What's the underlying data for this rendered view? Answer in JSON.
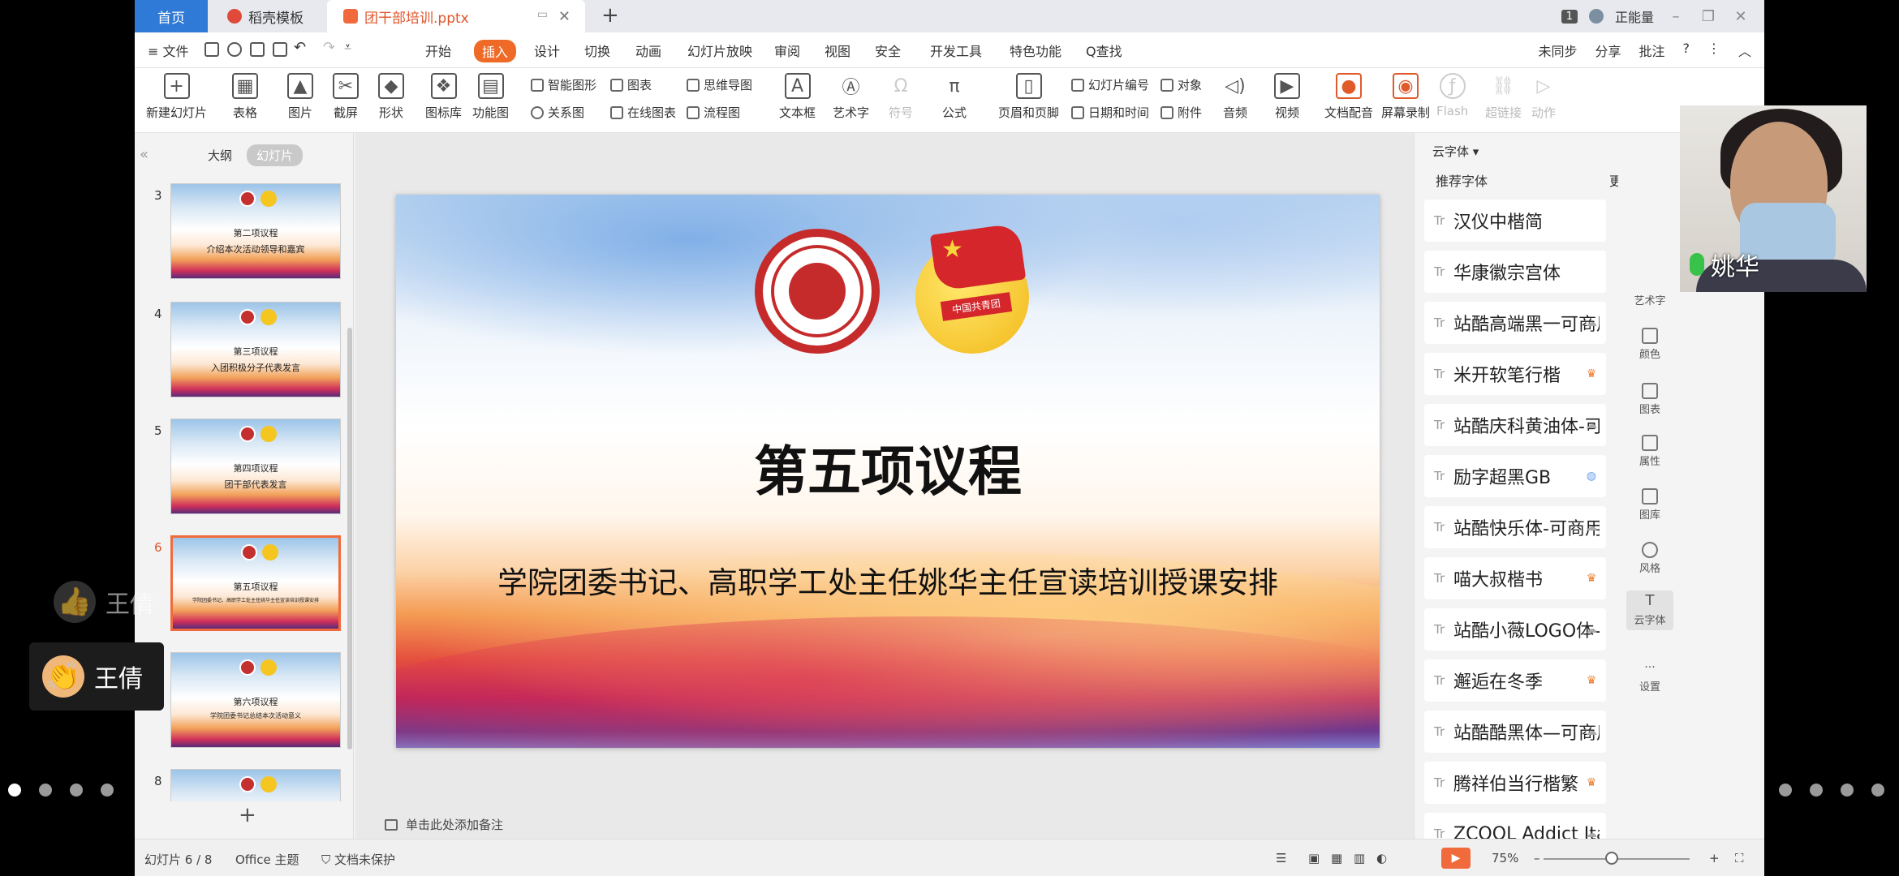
{
  "tabs": {
    "home": "首页",
    "template": "稻壳模板",
    "file": "团干部培训.pptx",
    "add": "+"
  },
  "titlebar_right": {
    "badge": "1",
    "user": "正能量",
    "min": "–",
    "max": "❐",
    "close": "✕"
  },
  "menu": {
    "file": "≡ 文件",
    "items": [
      "开始",
      "插入",
      "设计",
      "切换",
      "动画",
      "幻灯片放映",
      "审阅",
      "视图",
      "安全",
      "开发工具",
      "特色功能"
    ],
    "search": "Q查找",
    "sync": "未同步",
    "share": "分享",
    "comment": "批注",
    "help": "?",
    "more": "⋮",
    "collapse": "︿"
  },
  "ribbon": {
    "new_slide": "新建幻灯片",
    "table": "表格",
    "picture": "图片",
    "screenshot": "截屏",
    "shape": "形状",
    "icon_lib": "图标库",
    "func_chart": "功能图",
    "smart_graphic": "智能图形",
    "chart": "图表",
    "relation": "关系图",
    "online_chart": "在线图表",
    "mindmap": "思维导图",
    "flowchart": "流程图",
    "textbox": "文本框",
    "wordart": "艺术字",
    "symbol": "符号",
    "formula": "公式",
    "header_footer": "页眉和页脚",
    "slide_number": "幻灯片编号",
    "object": "对象",
    "date_time": "日期和时间",
    "attachment": "附件",
    "audio": "音频",
    "video": "视频",
    "doc_dub": "文档配音",
    "screen_record": "屏幕录制",
    "flash": "Flash",
    "hyperlink": "超链接",
    "action": "动作"
  },
  "left_panel": {
    "outline": "大纲",
    "slides": "幻灯片",
    "thumbnails": [
      {
        "num": "3",
        "line1": "第二项议程",
        "line2": "介绍本次活动领导和嘉宾"
      },
      {
        "num": "4",
        "line1": "第三项议程",
        "line2": "入团积极分子代表发言"
      },
      {
        "num": "5",
        "line1": "第四项议程",
        "line2": "团干部代表发言"
      },
      {
        "num": "6",
        "line1": "第五项议程",
        "line2": "学院团委书记、高职学工处主任姚华主任宣读培训授课安排"
      },
      {
        "num": "7",
        "line1": "第六项议程",
        "line2": "学院团委书记总结本次活动意义"
      },
      {
        "num": "8",
        "line1": "",
        "line2": ""
      }
    ]
  },
  "slide": {
    "title": "第五项议程",
    "subtitle": "学院团委书记、高职学工处主任姚华主任宣读培训授课安排",
    "emblem_text": "中国共青团"
  },
  "notes_placeholder": "单击此处添加备注",
  "font_panel": {
    "header": "云字体",
    "section": "推荐字体",
    "more": "更",
    "fonts": [
      {
        "name": "汉仪中楷简",
        "status": ""
      },
      {
        "name": "华康徽宗宫体",
        "status": ""
      },
      {
        "name": "站酷高端黑一可商用",
        "status": "cloud"
      },
      {
        "name": "米开软笔行楷",
        "status": "crown"
      },
      {
        "name": "站酷庆科黄油体-可商用",
        "status": "cloud"
      },
      {
        "name": "励字超黑GB",
        "status": "shield"
      },
      {
        "name": "站酷快乐体-可商用",
        "status": "cloud"
      },
      {
        "name": "喵大叔楷书",
        "status": "crown"
      },
      {
        "name": "站酷小薇LOGO体-可商用",
        "status": "cloud"
      },
      {
        "name": "邂逅在冬季",
        "status": "crown"
      },
      {
        "name": "站酷酷黑体—可商用",
        "status": "cloud"
      },
      {
        "name": "腾祥伯当行楷繁",
        "status": "crown"
      },
      {
        "name": "ZCOOL Addict Italic",
        "status": "cloud"
      }
    ]
  },
  "tool_rail": [
    {
      "label": "艺术字"
    },
    {
      "label": "颜色"
    },
    {
      "label": "图表"
    },
    {
      "label": "属性"
    },
    {
      "label": "图库"
    },
    {
      "label": "风格"
    },
    {
      "label": "云字体"
    },
    {
      "label": "设置"
    }
  ],
  "statusbar": {
    "slide_pos": "幻灯片 6 / 8",
    "theme": "Office 主题",
    "protect": "文档未保护",
    "zoom": "75%",
    "minus": "–",
    "plus": "+"
  },
  "meeting": {
    "speaker_name": "姚华",
    "reaction1_name": "王倩",
    "reaction1_emoji": "👍",
    "reaction2_name": "王倩",
    "reaction2_emoji": "👏"
  },
  "page_dots": {
    "left_count": 4,
    "right_count": 4
  }
}
